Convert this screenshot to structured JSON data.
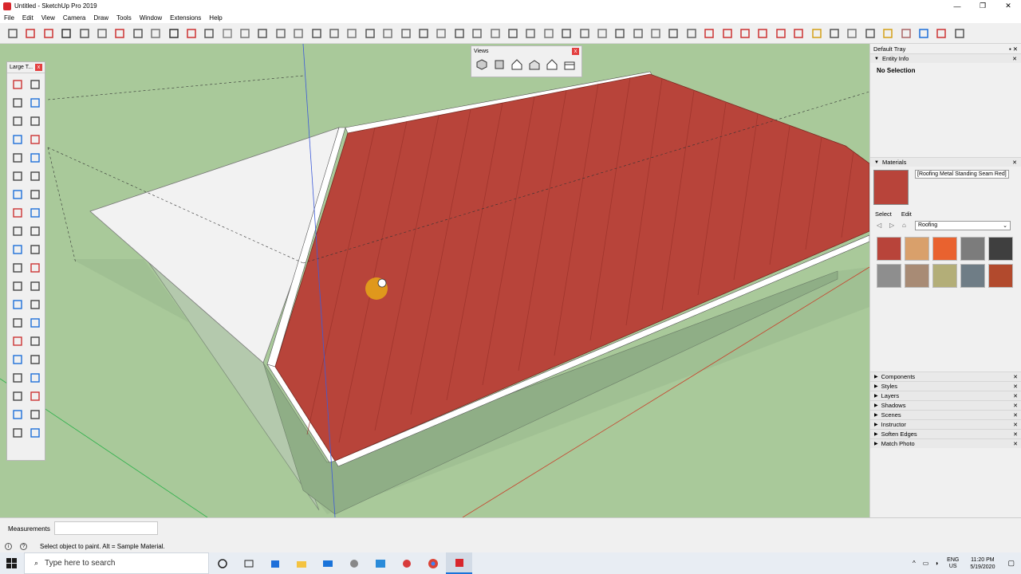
{
  "window": {
    "title": "Untitled - SketchUp Pro 2019",
    "controls": [
      "—",
      "❐",
      "✕"
    ]
  },
  "menu": [
    "File",
    "Edit",
    "View",
    "Camera",
    "Draw",
    "Tools",
    "Window",
    "Extensions",
    "Help"
  ],
  "palette": {
    "title": "Large T...",
    "close": "x"
  },
  "views_toolbar": {
    "title": "Views",
    "close": "x"
  },
  "tray": {
    "title": "Default Tray",
    "entity_info": {
      "header": "Entity Info",
      "body": "No Selection"
    },
    "materials": {
      "header": "Materials",
      "current_name": "[Roofing Metal Standing Seam Red]",
      "tab_select": "Select",
      "tab_edit": "Edit",
      "collection": "Roofing",
      "swatch_colors": [
        "#b8443a",
        "#d9a06b",
        "#e9622f",
        "#7c7c7c",
        "#3f3f3f",
        "#8e8e8e",
        "#a88b75",
        "#b3ae78",
        "#6f7d86",
        "#b24a2d"
      ]
    },
    "collapsed_sections": [
      "Components",
      "Styles",
      "Layers",
      "Shadows",
      "Scenes",
      "Instructor",
      "Soften Edges",
      "Match Photo"
    ]
  },
  "measurements": {
    "label": "Measurements",
    "value": ""
  },
  "status": {
    "hint": "Select object to paint. Alt = Sample Material."
  },
  "taskbar": {
    "search_placeholder": "Type here to search",
    "lang1": "ENG",
    "lang2": "US",
    "time": "11:20 PM",
    "date": "5/19/2020"
  },
  "colors": {
    "roof_red": "#b8443a",
    "ground_green": "#a9c99a",
    "wall_white": "#f2f2f2"
  }
}
